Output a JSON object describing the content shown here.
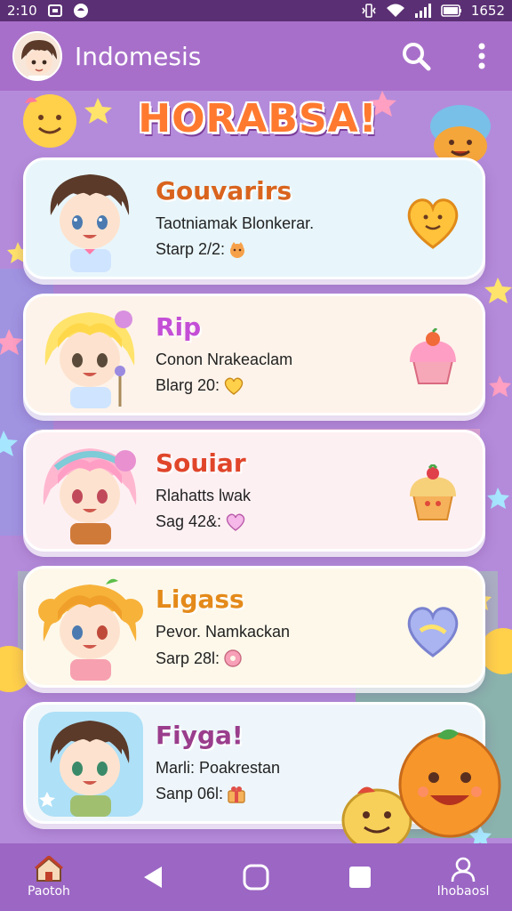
{
  "status_bar": {
    "time": "2:10",
    "clock": "1652",
    "icons": [
      "screenshot-icon",
      "notification-icon",
      "vibrate-icon",
      "wifi-icon",
      "signal-icon",
      "battery-icon"
    ]
  },
  "app_bar": {
    "title": "Indomesis",
    "icons": [
      "avatar",
      "search-icon",
      "more-vert-icon"
    ]
  },
  "banner": {
    "text": "HORABSA!"
  },
  "cards": [
    {
      "name": "Gouvarirs",
      "subtitle": "Taotniamak Blonkerar.",
      "score": "Starp 2/2:",
      "name_color": "#d9641e",
      "bg": "#e8f6fb",
      "badge": "heart-icon",
      "score_icon": "cat-icon"
    },
    {
      "name": "Rip",
      "subtitle": "Conon Nrakeaclam",
      "score": "Blarg 20:",
      "name_color": "#c44fd6",
      "bg": "#fdf3ea",
      "badge": "cupcake-icon",
      "score_icon": "heart-icon"
    },
    {
      "name": "Souiar",
      "subtitle": "Rlahatts lwak",
      "score": "Sag 42&:",
      "name_color": "#e0452a",
      "bg": "#fdf0f3",
      "badge": "cupcake-icon",
      "score_icon": "heart-icon"
    },
    {
      "name": "Ligass",
      "subtitle": "Pevor. Namkackan",
      "score": "Sarp 28l:",
      "name_color": "#e48a1a",
      "bg": "#fdf8ea",
      "badge": "heart-icon",
      "score_icon": "donut-icon"
    },
    {
      "name": "Fiyga!",
      "subtitle": "Marli: Poakrestan",
      "score": "Sanp 06l:",
      "name_color": "#9a3d8c",
      "bg": "#eef6fb",
      "badge": "orange-mascot-icon",
      "score_icon": "gift-icon"
    }
  ],
  "nav": {
    "home_label": "Paotoh",
    "profile_label": "Ihobaosl",
    "icons": [
      "home-icon",
      "back-icon",
      "home-circle-icon",
      "recents-icon",
      "profile-icon"
    ]
  },
  "colors": {
    "status_bar": "#5a2f73",
    "app_bar": "#a76fc9",
    "nav_bar": "#9b66c4",
    "accent": "#ff7a2f"
  }
}
